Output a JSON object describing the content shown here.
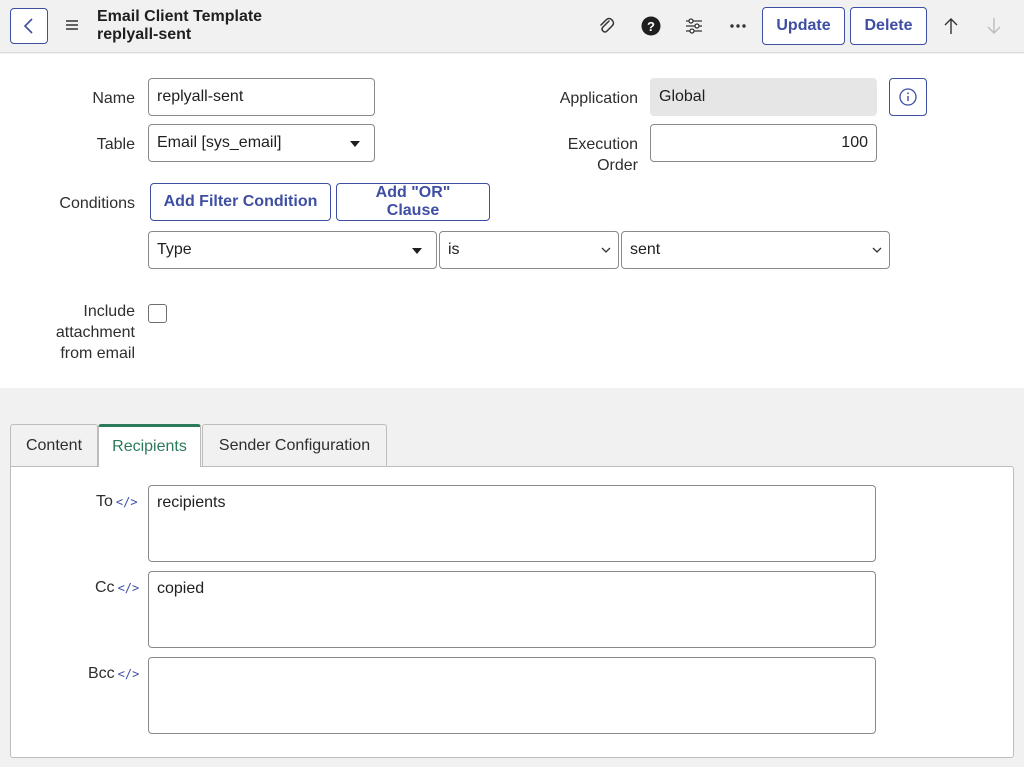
{
  "header": {
    "title_line1": "Email Client Template",
    "title_line2": "replyall-sent",
    "update_label": "Update",
    "delete_label": "Delete"
  },
  "form": {
    "name_label": "Name",
    "name_value": "replyall-sent",
    "table_label": "Table",
    "table_value": "Email [sys_email]",
    "application_label": "Application",
    "application_value": "Global",
    "execution_order_label_1": "Execution",
    "execution_order_label_2": "Order",
    "execution_order_value": "100",
    "conditions_label": "Conditions",
    "add_filter_label": "Add Filter Condition",
    "add_or_label": "Add \"OR\" Clause",
    "condition": {
      "field": "Type",
      "operator": "is",
      "value": "sent"
    },
    "include_attachment_label_1": "Include",
    "include_attachment_label_2": "attachment",
    "include_attachment_label_3": "from email",
    "include_attachment_checked": false
  },
  "tabs": {
    "items": [
      {
        "label": "Content",
        "active": false
      },
      {
        "label": "Recipients",
        "active": true
      },
      {
        "label": "Sender Configuration",
        "active": false
      }
    ]
  },
  "recipients": {
    "to_label": "To",
    "to_value": "recipients",
    "cc_label": "Cc",
    "cc_value": "copied",
    "bcc_label": "Bcc",
    "bcc_value": "",
    "script_icon_glyph": "</>"
  },
  "colors": {
    "accent": "#3e4ea3",
    "active_tab": "#2b7a5a"
  }
}
